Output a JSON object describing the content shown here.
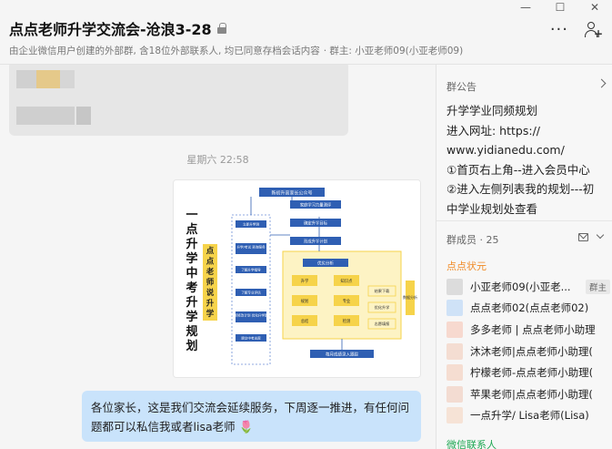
{
  "window": {
    "minimize": "—",
    "maximize": "☐",
    "close": "✕"
  },
  "header": {
    "title": "点点老师升学交流会-沧浪3-28",
    "subtitle": "由企业微信用户创建的外部群, 含18位外部联系人, 均已同意存档会话内容",
    "owner": "· 群主: 小亚老师09(小亚老师09)",
    "more": "···",
    "add_plus": "+"
  },
  "chat": {
    "timestamp": "星期六 22:58",
    "message_text": "各位家长，这是我们交流会延续服务，下周逐一推进，有任何问题都可以私信我或者lisa老师",
    "message_emoji": "🌷"
  },
  "image_content": {
    "vertical_title": [
      "一",
      "点",
      "升",
      "学",
      "中",
      "考",
      "升",
      "学",
      "规",
      "划"
    ],
    "vertical_tag": [
      "点",
      "点",
      "老",
      "师",
      "说",
      "升",
      "学"
    ],
    "top_box": "新初升高家长公众号",
    "left_steps": [
      "立即升学测",
      "升学/考试 咨询服务",
      "了解升学指导",
      "了解专业评估",
      "不断修改计划 优化升学路径",
      "提交中考志愿"
    ],
    "center_steps": [
      "家庭学习力量测评",
      "确定升学目标",
      "形成升学计划"
    ],
    "panel_title": "优劣分析",
    "panel_items": [
      "升学",
      "知识点",
      "规划",
      "专业",
      "总结",
      "检测"
    ],
    "right_items": [
      "结果下载",
      "优化升学",
      "志愿填报"
    ],
    "side_label": "数据分析",
    "bottom_box": "每月成绩录入跟踪",
    "colors": {
      "blue": "#2f5fb3",
      "yellow": "#f6d34a",
      "light_yellow": "#fdf3c4"
    }
  },
  "sidebar": {
    "notice_title": "群公告",
    "notice_lines": [
      "升学学业同频规划",
      "进入网址:   https://",
      "www.yidianedu.com/",
      "①首页右上角--进入会员中心",
      "②进入左侧列表我的规划---初",
      "中学业规划处查看"
    ],
    "members_title": "群成员 · 25",
    "member_group": "点点状元",
    "members": [
      {
        "name": "小亚老师09(小亚老...",
        "badge": "群主",
        "color": "#dcdcdc"
      },
      {
        "name": "点点老师02(点点老师02)",
        "badge": "",
        "color": "#cfe2f7"
      },
      {
        "name": "多多老师 | 点点老师小助理",
        "badge": "",
        "color": "#f7d9cf"
      },
      {
        "name": "沐沐老师|点点老师小助理(",
        "badge": "",
        "color": "#f4ddd2"
      },
      {
        "name": "柠檬老师-点点老师小助理(",
        "badge": "",
        "color": "#f5ddd1"
      },
      {
        "name": "苹果老师|点点老师小助理(",
        "badge": "",
        "color": "#f3dcd2"
      },
      {
        "name": "一点升学/ Lisa老师(Lisa)",
        "badge": "",
        "color": "#f6e3d6"
      }
    ],
    "wechat_title": "微信联系人"
  }
}
